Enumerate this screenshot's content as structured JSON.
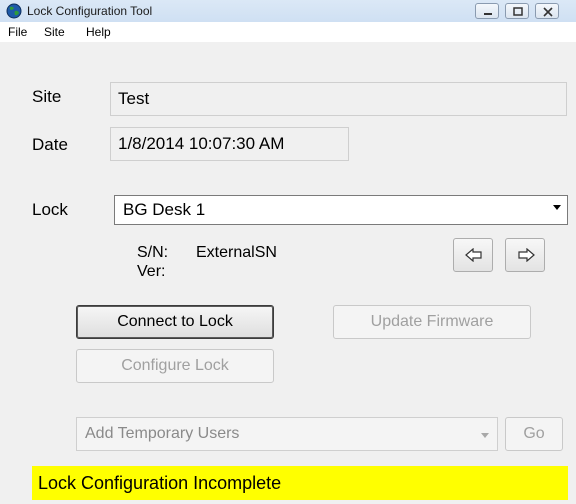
{
  "window": {
    "title": "Lock Configuration Tool"
  },
  "menu": [
    "File",
    "Site",
    "Help"
  ],
  "site": {
    "label": "Site",
    "value": "Test"
  },
  "date": {
    "label": "Date",
    "value": "1/8/2014 10:07:30 AM"
  },
  "lock": {
    "label": "Lock",
    "selected": "BG Desk 1",
    "sn_label": "S/N:",
    "sn_value": "ExternalSN",
    "ver_label": "Ver:",
    "ver_value": ""
  },
  "buttons": {
    "connect": "Connect to Lock",
    "update_firmware": "Update Firmware",
    "configure": "Configure Lock",
    "go": "Go"
  },
  "temp_users": {
    "selected": "Add Temporary Users"
  },
  "status": {
    "text": "Lock Configuration Incomplete",
    "color": "#ffff00"
  },
  "icons": [
    "app-globe-icon",
    "minimize-icon",
    "maximize-icon",
    "close-icon",
    "arrow-left-icon",
    "arrow-right-icon",
    "chevron-down-icon"
  ]
}
